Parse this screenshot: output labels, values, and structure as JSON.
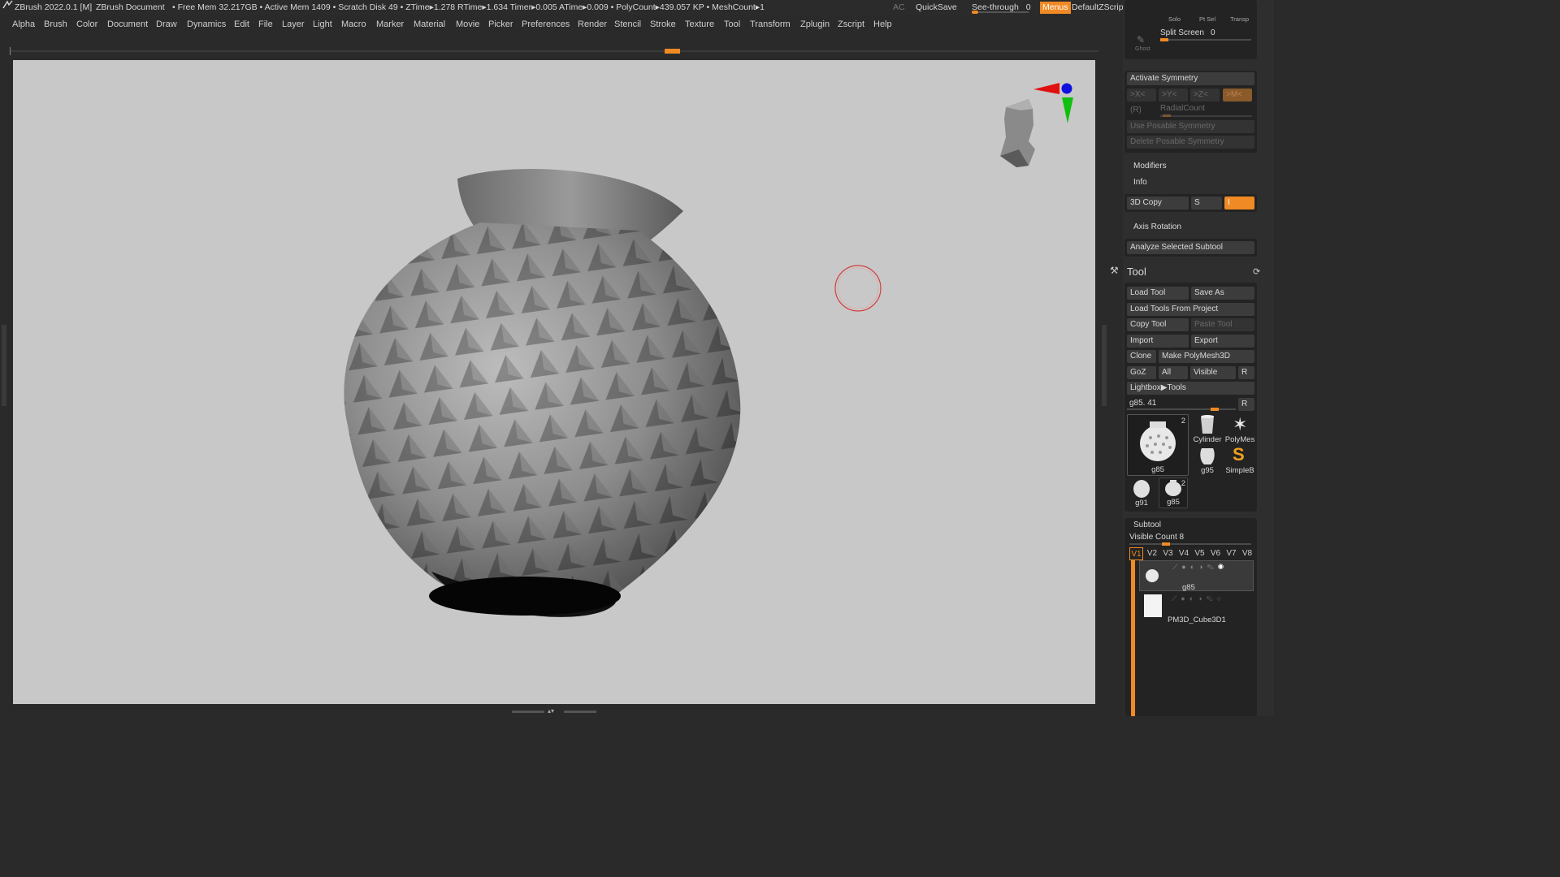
{
  "titlebar": {
    "app": "ZBrush 2022.0.1 [M]",
    "doc": "ZBrush Document",
    "stats": "• Free Mem 32.217GB • Active Mem 1409 • Scratch Disk 49 •  ZTime▸1.278 RTime▸1.634 Timer▸0.005 ATime▸0.009 • PolyCount▸439.057 KP  • MeshCount▸1",
    "ac": "AC",
    "quicksave": "QuickSave",
    "seethrough": "See-through",
    "seethrough_value": "0",
    "menus": "Menus",
    "script": "DefaultZScript"
  },
  "menubar": [
    "Alpha",
    "Brush",
    "Color",
    "Document",
    "Draw",
    "Dynamics",
    "Edit",
    "File",
    "Layer",
    "Light",
    "Macro",
    "Marker",
    "Material",
    "Movie",
    "Picker",
    "Preferences",
    "Render",
    "Stencil",
    "Stroke",
    "Texture",
    "Tool",
    "Transform",
    "Zplugin",
    "Zscript",
    "Help"
  ],
  "panel": {
    "solo": "Solo",
    "ptsel": "Pt Sel",
    "transp": "Transp",
    "ghost": "Ghost",
    "split_screen": "Split Screen",
    "split_screen_value": "0",
    "activate_symmetry": "Activate Symmetry",
    "sym_x": ">X<",
    "sym_y": ">Y<",
    "sym_z": ">Z<",
    "sym_m": ">M<",
    "sym_r": "(R)",
    "radial_count": "RadialCount",
    "use_posable": "Use Posable Symmetry",
    "delete_posable": "Delete Posable Symmetry",
    "modifiers": "Modifiers",
    "info": "Info",
    "copy3d": "3D Copy",
    "copy3d_s": "S",
    "copy3d_i": "I",
    "axis_rotation": "Axis Rotation",
    "analyze": "Analyze Selected Subtool"
  },
  "tool": {
    "title": "Tool",
    "load_tool": "Load Tool",
    "save_as": "Save As",
    "load_from_project": "Load Tools From Project",
    "copy_tool": "Copy Tool",
    "paste_tool": "Paste Tool",
    "import": "Import",
    "export": "Export",
    "clone": "Clone",
    "make_polymesh": "Make PolyMesh3D",
    "goz": "GoZ",
    "all": "All",
    "visible": "Visible",
    "r": "R",
    "lightbox": "Lightbox▶Tools",
    "current_tool": "g85. 41",
    "current_r": "R",
    "thumbs": [
      {
        "label": "g85",
        "count": "2"
      },
      {
        "label": "Cylinder"
      },
      {
        "label": "PolyMes"
      },
      {
        "label": "g95"
      },
      {
        "label": "SimpleB"
      },
      {
        "label": "g91"
      },
      {
        "label": "g85",
        "count": "2"
      }
    ]
  },
  "subtool": {
    "title": "Subtool",
    "visible_count": "Visible Count 8",
    "tabs": [
      "V1",
      "V2",
      "V3",
      "V4",
      "V5",
      "V6",
      "V7",
      "V8"
    ],
    "items": [
      {
        "name": "g85"
      },
      {
        "name": "PM3D_Cube3D1"
      }
    ]
  },
  "colors": {
    "accent": "#f08a24",
    "canvas_bg": "#c8c8c8",
    "panel_bg": "#2e2e2e",
    "cursor_ring": "#d04040"
  }
}
